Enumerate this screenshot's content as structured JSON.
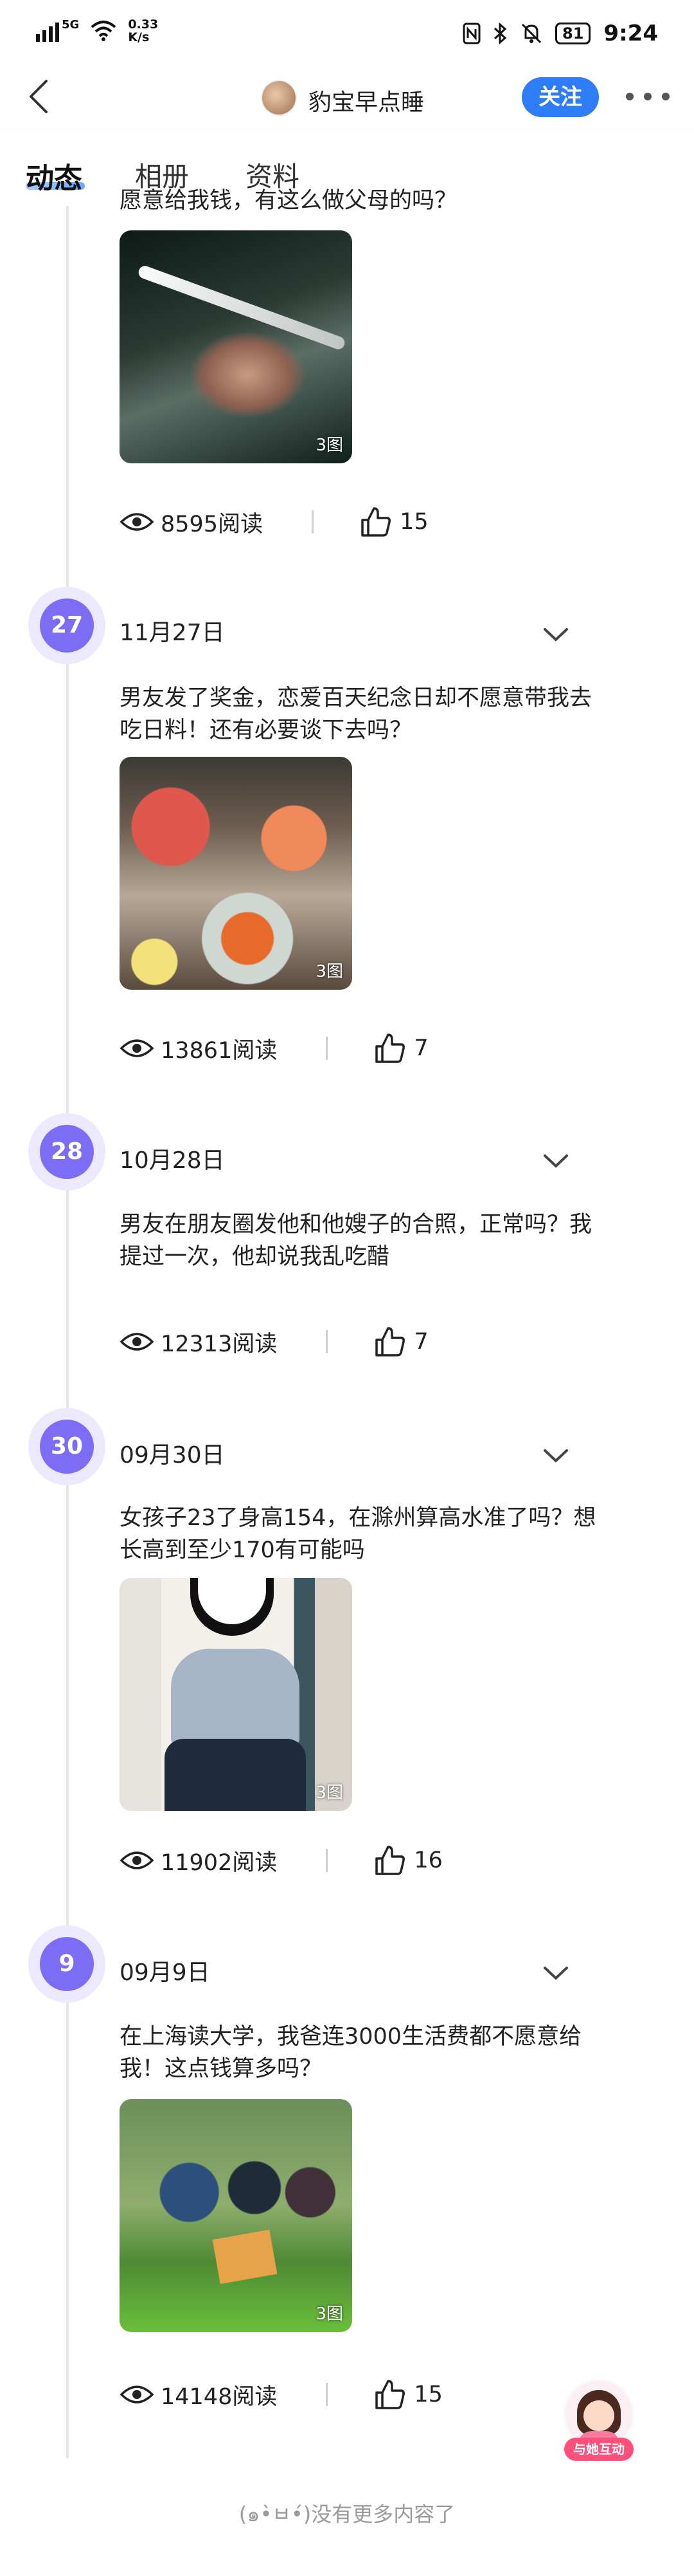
{
  "status_bar": {
    "network": "5G",
    "speed_value": "0.33",
    "speed_unit": "K/s",
    "battery": "81",
    "time": "9:24"
  },
  "header": {
    "nickname": "豹宝早点睡",
    "follow_label": "关注"
  },
  "tabs": [
    {
      "label": "动态",
      "active": true
    },
    {
      "label": "相册",
      "active": false
    },
    {
      "label": "资料",
      "active": false
    }
  ],
  "posts": [
    {
      "text": "愿意给我钱，有这么做父母的吗？",
      "image_count": "3图",
      "reads": "8595阅读",
      "likes": "15"
    },
    {
      "day": "27",
      "date": "11月27日",
      "text": "男友发了奖金，恋爱百天纪念日却不愿意带我去吃日料！还有必要谈下去吗？",
      "image_count": "3图",
      "reads": "13861阅读",
      "likes": "7"
    },
    {
      "day": "28",
      "date": "10月28日",
      "text": "男友在朋友圈发他和他嫂子的合照，正常吗？我提过一次，他却说我乱吃醋",
      "reads": "12313阅读",
      "likes": "7"
    },
    {
      "day": "30",
      "date": "09月30日",
      "text": "女孩子23了身高154，在滁州算高水准了吗？想长高到至少170有可能吗",
      "image_count": "3图",
      "reads": "11902阅读",
      "likes": "16"
    },
    {
      "day": "9",
      "date": "09月9日",
      "text": "在上海读大学，我爸连3000生活费都不愿意给我！这点钱算多吗？",
      "image_count": "3图",
      "reads": "14148阅读",
      "likes": "15"
    }
  ],
  "floating_button": {
    "label": "与她互动"
  },
  "footer": {
    "no_more": "(๑•̀ㅂ•́)没有更多内容了"
  },
  "colors": {
    "accent": "#2f7df6",
    "badge": "#7d6cf4",
    "badge_halo": "#ece9ff",
    "timeline": "#e6e6e6"
  },
  "icons": [
    "back-icon",
    "more-icon",
    "eye-icon",
    "thumb-up-icon",
    "chevron-down-icon",
    "wifi-icon",
    "bluetooth-icon",
    "nfc-icon",
    "mute-icon"
  ]
}
